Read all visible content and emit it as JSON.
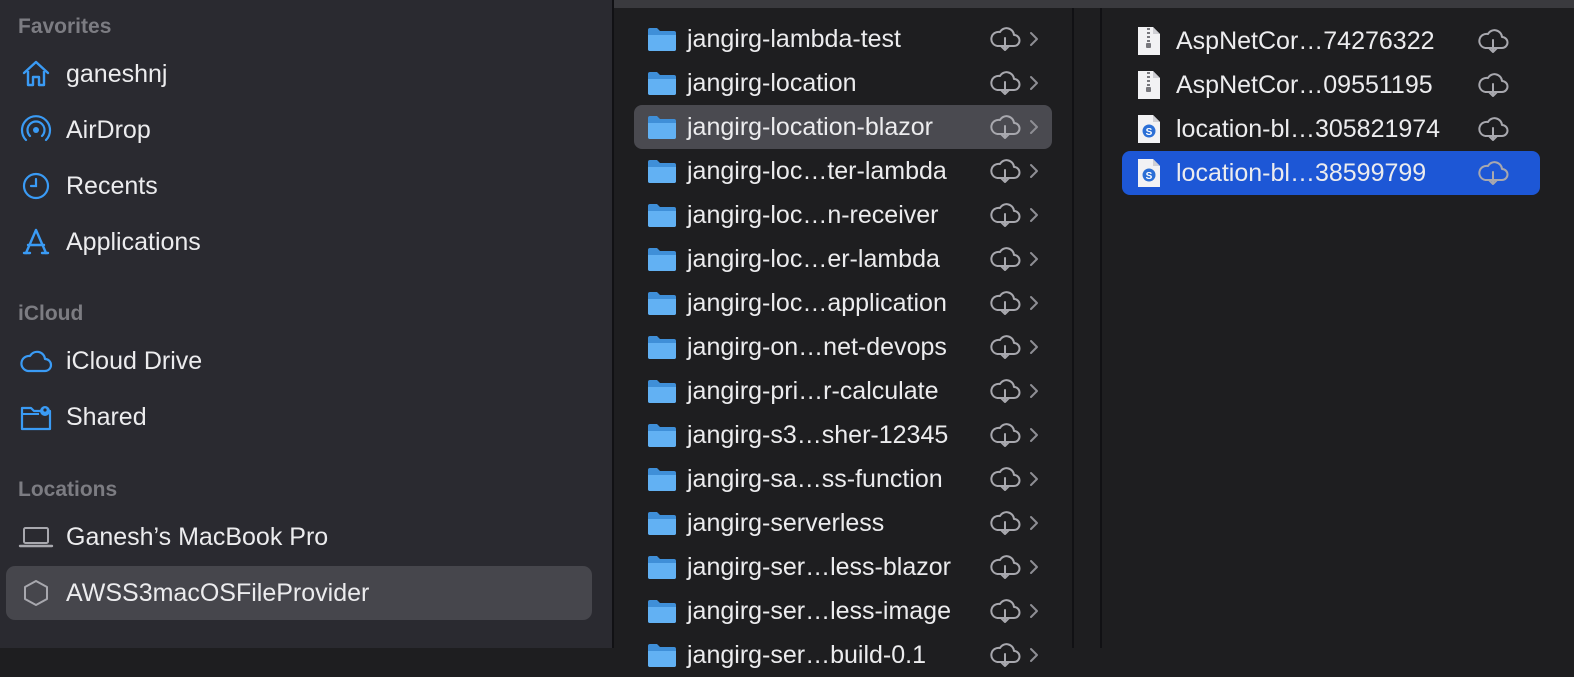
{
  "sidebar": {
    "favorites_title": "Favorites",
    "favorites": [
      {
        "label": "ganeshnj",
        "icon": "home-icon"
      },
      {
        "label": "AirDrop",
        "icon": "airdrop-icon"
      },
      {
        "label": "Recents",
        "icon": "clock-icon"
      },
      {
        "label": "Applications",
        "icon": "applications-icon"
      }
    ],
    "icloud_title": "iCloud",
    "icloud": [
      {
        "label": "iCloud Drive",
        "icon": "cloud-icon"
      },
      {
        "label": "Shared",
        "icon": "shared-folder-icon"
      }
    ],
    "locations_title": "Locations",
    "locations": [
      {
        "label": "Ganesh’s MacBook Pro",
        "icon": "laptop-icon"
      },
      {
        "label": "AWSS3macOSFileProvider",
        "icon": "hexagon-icon",
        "selected": true
      }
    ]
  },
  "folders": [
    {
      "label": "jangirg-lambda-test"
    },
    {
      "label": "jangirg-location"
    },
    {
      "label": "jangirg-location-blazor",
      "selected": true
    },
    {
      "label": "jangirg-loc…ter-lambda"
    },
    {
      "label": "jangirg-loc…n-receiver"
    },
    {
      "label": "jangirg-loc…er-lambda"
    },
    {
      "label": "jangirg-loc…application"
    },
    {
      "label": "jangirg-on…net-devops"
    },
    {
      "label": "jangirg-pri…r-calculate"
    },
    {
      "label": "jangirg-s3…sher-12345"
    },
    {
      "label": "jangirg-sa…ss-function"
    },
    {
      "label": "jangirg-serverless"
    },
    {
      "label": "jangirg-ser…less-blazor"
    },
    {
      "label": "jangirg-ser…less-image"
    },
    {
      "label": "jangirg-ser…build-0.1"
    }
  ],
  "files": [
    {
      "label": "AspNetCor…74276322",
      "icon": "zip-file-icon"
    },
    {
      "label": "AspNetCor…09551195",
      "icon": "zip-file-icon"
    },
    {
      "label": "location-bl…305821974",
      "icon": "script-file-icon"
    },
    {
      "label": "location-bl…38599799",
      "icon": "script-file-icon",
      "selected": true
    }
  ],
  "colors": {
    "accent": "#1d57d6",
    "icon_blue": "#3a9bf5",
    "sidebar_bg": "#2a2a30",
    "content_bg": "#1e1e20",
    "selected_gray": "#4a4a50"
  }
}
